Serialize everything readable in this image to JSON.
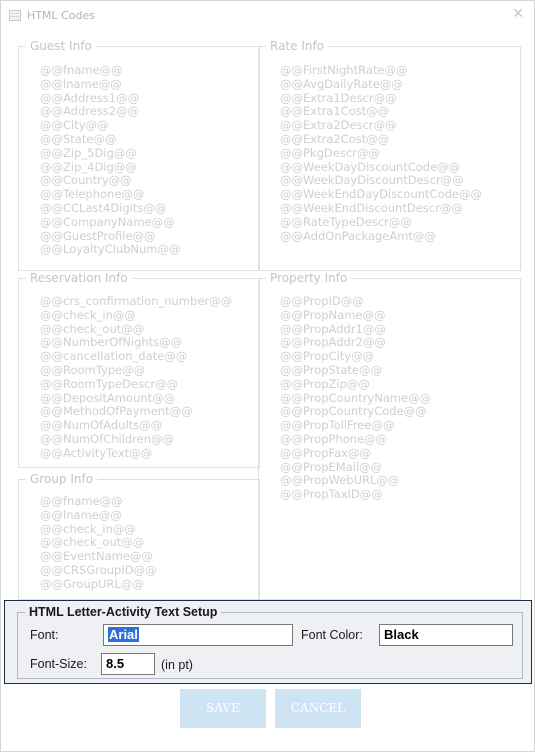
{
  "window": {
    "title": "HTML Codes",
    "close_glyph": "✕",
    "icon": "app-icon"
  },
  "guest": {
    "legend": "Guest Info",
    "codes": [
      "@@fname@@",
      "@@lname@@",
      "@@Address1@@",
      "@@Address2@@",
      "@@City@@",
      "@@State@@",
      "@@Zip_5Dig@@",
      "@@Zip_4Dig@@",
      "@@Country@@",
      "@@Telephone@@",
      "@@CCLast4Digits@@",
      "@@CompanyName@@",
      "@@GuestProfile@@",
      "@@LoyaltyClubNum@@"
    ]
  },
  "rate": {
    "legend": "Rate Info",
    "codes": [
      "@@FirstNightRate@@",
      "@@AvgDailyRate@@",
      "@@Extra1Descr@@",
      "@@Extra1Cost@@",
      "@@Extra2Descr@@",
      "@@Extra2Cost@@",
      "@@PkgDescr@@",
      "@@WeekDayDiscountCode@@",
      "@@WeekDayDiscountDescr@@",
      "@@WeekEndDayDiscountCode@@",
      "@@WeekEndDiscountDescr@@",
      "@@RateTypeDescr@@",
      "@@AddOnPackageAmt@@"
    ]
  },
  "reservation": {
    "legend": "Reservation Info",
    "codes": [
      "@@crs_confirmation_number@@",
      "@@check_in@@",
      "@@check_out@@",
      "@@NumberOfNights@@",
      "@@cancellation_date@@",
      "@@RoomType@@",
      "@@RoomTypeDescr@@",
      "@@DepositAmount@@",
      "@@MethodOfPayment@@",
      "@@NumOfAdults@@",
      "@@NumOfChildren@@",
      "@@ActivityText@@"
    ]
  },
  "property": {
    "legend": "Property Info",
    "codes": [
      "@@PropID@@",
      "@@PropName@@",
      "@@PropAddr1@@",
      "@@PropAddr2@@",
      "@@PropCity@@",
      "@@PropState@@",
      "@@PropZip@@",
      "@@PropCountryName@@",
      "@@PropCountryCode@@",
      "@@PropTollFree@@",
      "@@PropPhone@@",
      "@@PropFax@@",
      "@@PropEMail@@",
      "@@PropWebURL@@",
      "@@PropTaxID@@"
    ]
  },
  "group": {
    "legend": "Group Info",
    "codes": [
      "@@fname@@",
      "@@lname@@",
      "@@check_in@@",
      "@@check_out@@",
      "@@EventName@@",
      "@@CRSGroupID@@",
      "@@GroupURL@@"
    ]
  },
  "setup": {
    "title": "HTML Letter-Activity Text Setup",
    "font_label": "Font:",
    "font_value": "Arial",
    "font_color_label": "Font Color:",
    "font_color_value": "Black",
    "font_size_label": "Font-Size:",
    "font_size_value": "8.5",
    "font_size_unit": "(in pt)"
  },
  "buttons": {
    "save": "SAVE",
    "cancel": "CANCEL"
  }
}
